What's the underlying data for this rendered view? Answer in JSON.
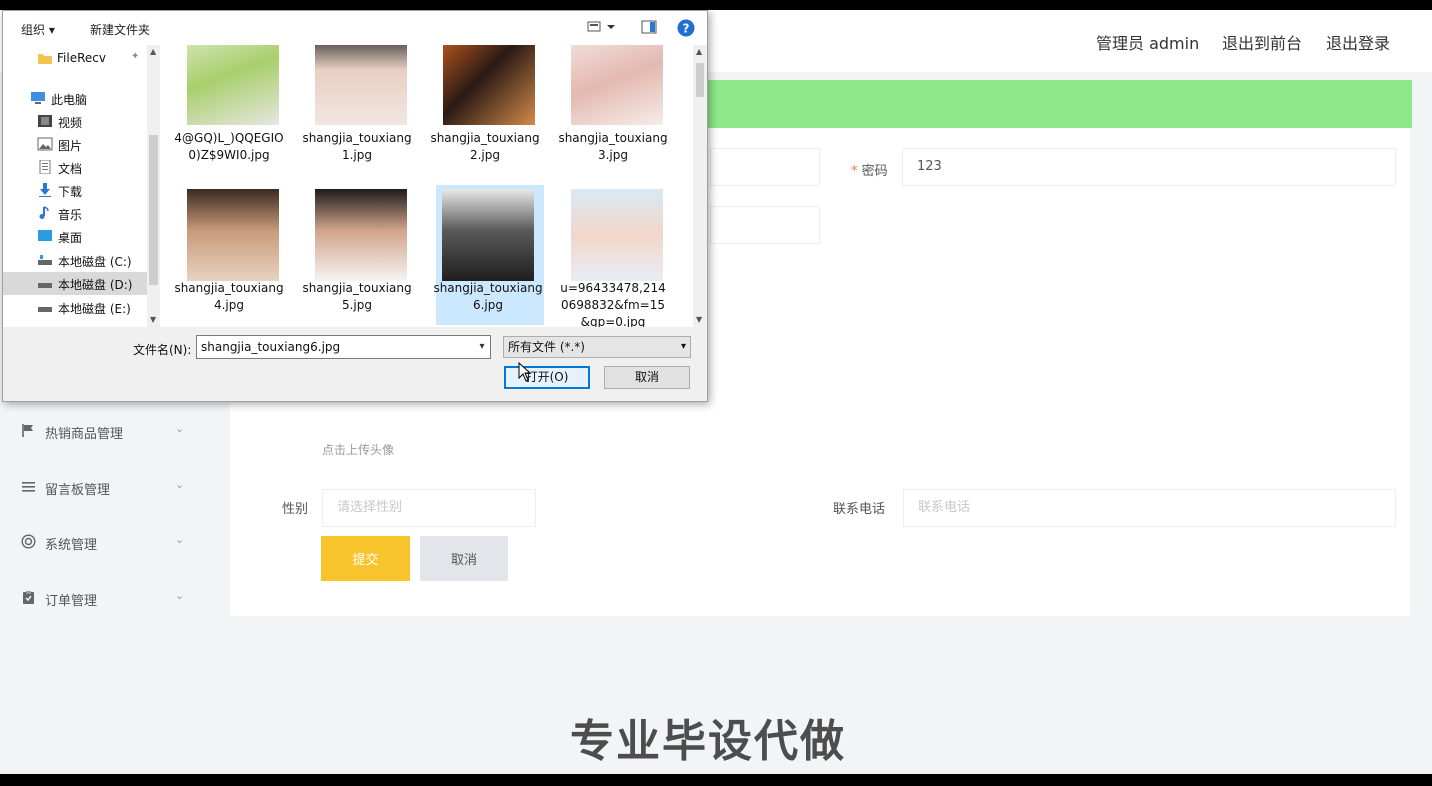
{
  "header": {
    "admin_label": "管理员 admin",
    "exit_front_label": "退出到前台",
    "logout_label": "退出登录"
  },
  "sidebar": {
    "items": [
      {
        "label": "热销商品管理",
        "icon": "flag-icon"
      },
      {
        "label": "留言板管理",
        "icon": "list-icon"
      },
      {
        "label": "系统管理",
        "icon": "settings-circle-icon"
      },
      {
        "label": "订单管理",
        "icon": "clipboard-icon"
      }
    ]
  },
  "form": {
    "password_required_mark": "*",
    "password_label": "密码",
    "password_value": "123",
    "upload_hint": "点击上传头像",
    "gender_label": "性别",
    "gender_placeholder": "请选择性别",
    "phone_label": "联系电话",
    "phone_placeholder": "联系电话",
    "submit_label": "提交",
    "cancel_label": "取消"
  },
  "watermark": "专业毕设代做",
  "dialog": {
    "toolbar": {
      "organize_label": "组织 ▾",
      "new_folder_label": "新建文件夹"
    },
    "tree": [
      {
        "label": "FileRecv",
        "icon": "folder-icon",
        "selected": false
      },
      {
        "label": "此电脑",
        "icon": "computer-icon",
        "selected": false
      },
      {
        "label": "视频",
        "icon": "video-icon",
        "selected": false
      },
      {
        "label": "图片",
        "icon": "picture-icon",
        "selected": false
      },
      {
        "label": "文档",
        "icon": "document-icon",
        "selected": false
      },
      {
        "label": "下载",
        "icon": "download-icon",
        "selected": false
      },
      {
        "label": "音乐",
        "icon": "music-icon",
        "selected": false
      },
      {
        "label": "桌面",
        "icon": "desktop-icon",
        "selected": false
      },
      {
        "label": "本地磁盘 (C:)",
        "icon": "drive-icon",
        "selected": false
      },
      {
        "label": "本地磁盘 (D:)",
        "icon": "drive-icon",
        "selected": true
      },
      {
        "label": "本地磁盘 (E:)",
        "icon": "drive-icon",
        "selected": false
      }
    ],
    "files": [
      {
        "name": "4@GQ)L_)QQEGIO0)Z$9WI0.jpg",
        "selected": false
      },
      {
        "name": "shangjia_touxiang1.jpg",
        "selected": false
      },
      {
        "name": "shangjia_touxiang2.jpg",
        "selected": false
      },
      {
        "name": "shangjia_touxiang3.jpg",
        "selected": false
      },
      {
        "name": "shangjia_touxiang4.jpg",
        "selected": false
      },
      {
        "name": "shangjia_touxiang5.jpg",
        "selected": false
      },
      {
        "name": "shangjia_touxiang6.jpg",
        "selected": true
      },
      {
        "name": "u=96433478,2140698832&fm=15&gp=0.jpg",
        "selected": false
      }
    ],
    "filename_label": "文件名(N):",
    "filename_value": "shangjia_touxiang6.jpg",
    "filter_value": "所有文件 (*.*)",
    "open_label": "打开(O)",
    "cancel_label": "取消"
  },
  "colors": {
    "green_bar": "#8de98a",
    "submit_button": "#f8c42b",
    "dialog_accent": "#0078d7",
    "selected_file": "#cce8ff"
  }
}
